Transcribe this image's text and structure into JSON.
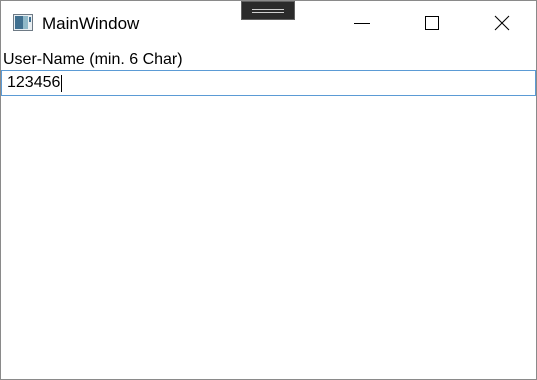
{
  "window": {
    "title": "MainWindow",
    "icon": "wpf-window-icon"
  },
  "caption_buttons": {
    "minimize_icon": "minimize-icon",
    "maximize_icon": "maximize-icon",
    "close_icon": "close-icon"
  },
  "form": {
    "username_label": "User-Name (min. 6 Char)",
    "username_value": "123456"
  },
  "colors": {
    "input_focus_border": "#5b9bd5",
    "window_border": "#8a8a8a"
  }
}
